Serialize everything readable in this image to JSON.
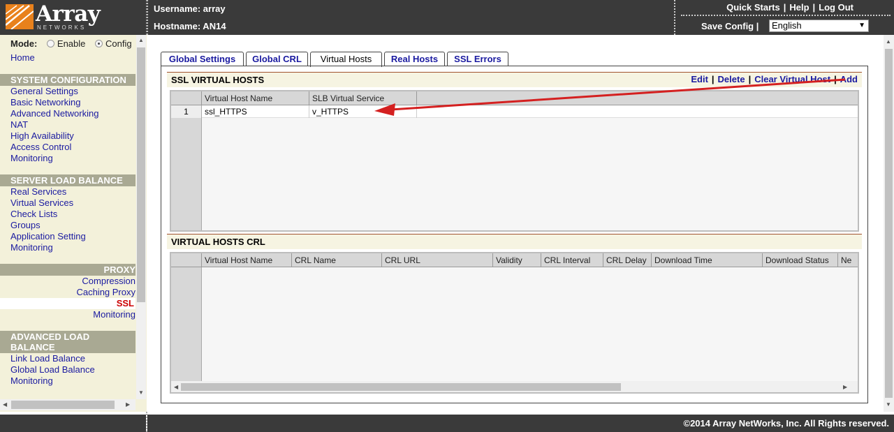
{
  "header": {
    "logo_text": "Array",
    "logo_sub": "NETWORKS",
    "username_label": "Username: array",
    "hostname_label": "Hostname: AN14",
    "links": [
      "Quick Starts",
      "Help",
      "Log Out"
    ],
    "save_config": "Save Config",
    "language": "English"
  },
  "sidebar": {
    "mode_label": "Mode:",
    "mode_enable": "Enable",
    "mode_config": "Config",
    "home": "Home",
    "sections": {
      "system": {
        "title": "SYSTEM CONFIGURATION",
        "items": [
          "General Settings",
          "Basic Networking",
          "Advanced Networking",
          "NAT",
          "High Availability",
          "Access Control",
          "Monitoring"
        ]
      },
      "slb": {
        "title": "SERVER LOAD BALANCE",
        "items": [
          "Real Services",
          "Virtual Services",
          "Check Lists",
          "Groups",
          "Application Setting",
          "Monitoring"
        ]
      },
      "proxy": {
        "title": "PROXY",
        "items": [
          "Compression",
          "Caching Proxy",
          "SSL",
          "Monitoring"
        ]
      },
      "alb": {
        "title_line1": "ADVANCED LOAD",
        "title_line2": "BALANCE",
        "items": [
          "Link Load Balance",
          "Global Load Balance",
          "Monitoring"
        ]
      }
    }
  },
  "tabs": [
    {
      "label": "Global Settings",
      "active": false
    },
    {
      "label": "Global CRL",
      "active": false
    },
    {
      "label": "Virtual Hosts",
      "active": true
    },
    {
      "label": "Real Hosts",
      "active": false
    },
    {
      "label": "SSL Errors",
      "active": false
    }
  ],
  "ssl_virtual_hosts": {
    "title": "SSL VIRTUAL HOSTS",
    "actions": [
      "Edit",
      "Delete",
      "Clear Virtual Host",
      "Add"
    ],
    "columns": [
      "Virtual Host Name",
      "SLB Virtual Service"
    ],
    "rows": [
      {
        "num": "1",
        "name": "ssl_HTTPS",
        "service": "v_HTTPS"
      }
    ]
  },
  "virtual_hosts_crl": {
    "title": "VIRTUAL HOSTS CRL",
    "columns": [
      "Virtual Host Name",
      "CRL Name",
      "CRL URL",
      "Validity",
      "CRL Interval",
      "CRL Delay",
      "Download Time",
      "Download Status",
      "Ne"
    ]
  },
  "footer": {
    "copyright": "©2014 Array NetWorks, Inc. All Rights reserved."
  },
  "colors": {
    "header_bg": "#3a3a3a",
    "sidebar_bg": "#f3f1da",
    "section_bg": "#a9a993",
    "link": "#1a1aa0",
    "active_nav": "#cc0000",
    "annotation_arrow": "#d42020",
    "logo_accent": "#e8811c"
  }
}
